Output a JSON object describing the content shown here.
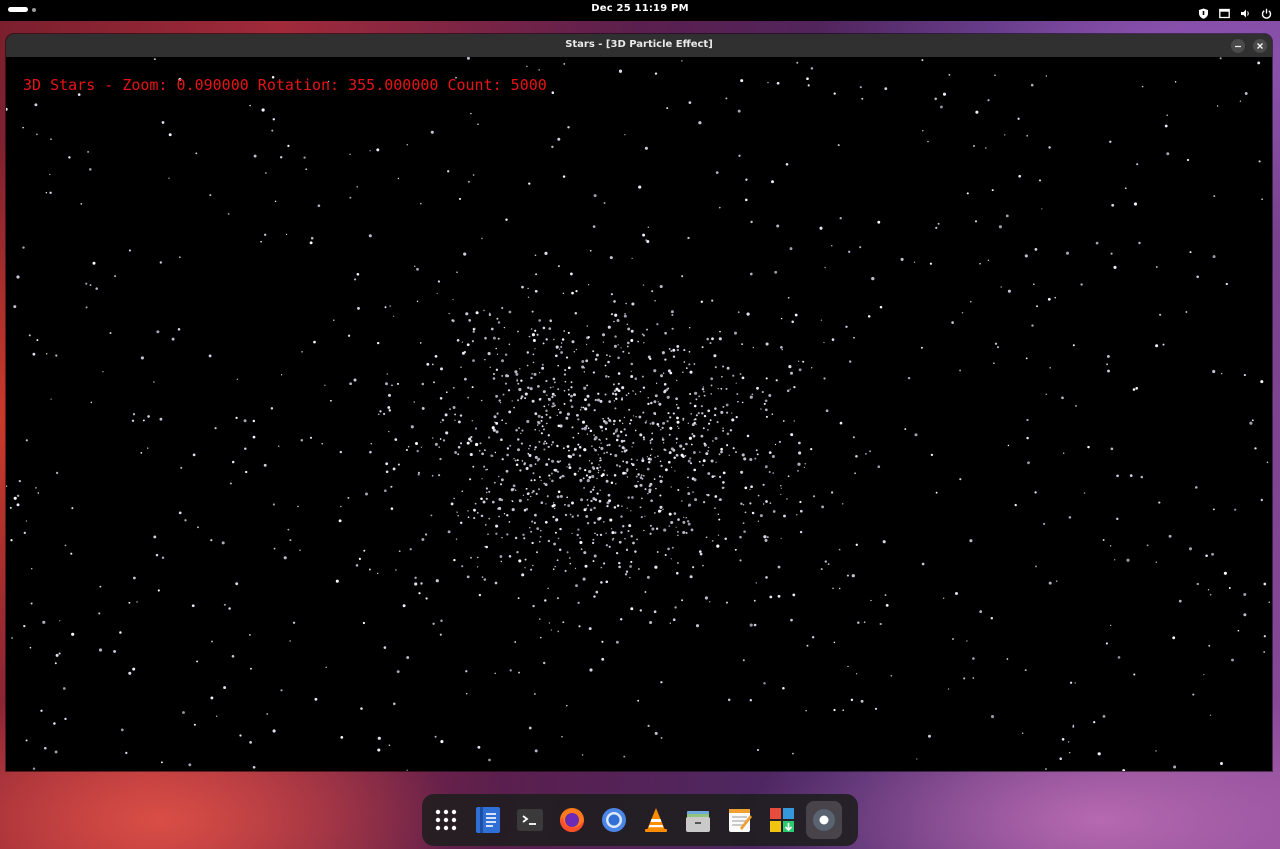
{
  "topbar": {
    "clock": "Dec 25  11:19 PM",
    "tray_icons": [
      "shield-icon",
      "window-icon",
      "volume-icon",
      "power-icon"
    ]
  },
  "window": {
    "title": "Stars - [3D Particle Effect]",
    "hud_text": "3D Stars - Zoom: 0.090000 Rotation: 355.000000 Count: 5000",
    "hud_color": "#e81414",
    "background_color": "#000000"
  },
  "dock": {
    "apps": [
      {
        "name": "show-apps-icon"
      },
      {
        "name": "text-editor-icon"
      },
      {
        "name": "terminal-icon"
      },
      {
        "name": "firefox-icon"
      },
      {
        "name": "chromium-icon"
      },
      {
        "name": "vlc-icon"
      },
      {
        "name": "files-icon"
      },
      {
        "name": "notes-icon"
      },
      {
        "name": "software-center-icon"
      },
      {
        "name": "settings-icon"
      }
    ]
  }
}
